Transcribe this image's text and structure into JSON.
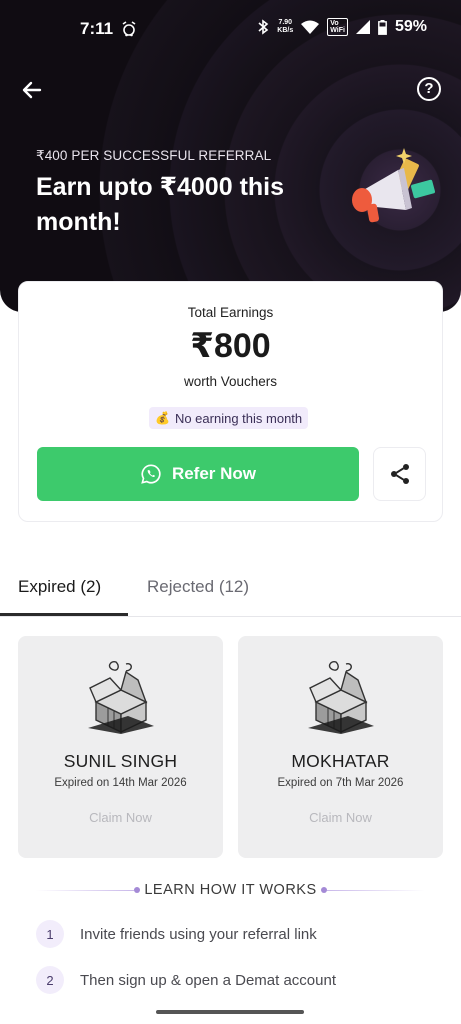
{
  "status": {
    "time": "7:11",
    "speed_value": "7.90",
    "speed_unit": "KB/s",
    "volte_top": "Vo",
    "volte_bottom": "WiFi",
    "battery": "59%"
  },
  "hero": {
    "subtitle": "₹400 PER SUCCESSFUL REFERRAL",
    "title": "Earn upto ₹4000 this month!",
    "help_label": "?"
  },
  "earnings": {
    "label": "Total Earnings",
    "amount": "₹800",
    "worth": "worth Vouchers",
    "badge_icon": "💰",
    "badge": "No earning this month"
  },
  "actions": {
    "refer_label": "Refer Now"
  },
  "tabs": [
    {
      "label": "Expired (2)",
      "active": true
    },
    {
      "label": "Rejected (12)",
      "active": false
    }
  ],
  "referrals": [
    {
      "name": "SUNIL SINGH",
      "date": "Expired on 14th Mar 2026",
      "claim": "Claim Now"
    },
    {
      "name": "MOKHATAR",
      "date": "Expired on 7th Mar 2026",
      "claim": "Claim Now"
    }
  ],
  "learn": {
    "heading": "LEARN HOW IT WORKS",
    "steps": [
      {
        "num": "1",
        "text": "Invite friends using your referral link"
      },
      {
        "num": "2",
        "text": "Then sign up & open a Demat account"
      }
    ]
  },
  "colors": {
    "refer_button": "#3dca6c",
    "badge_bg": "#f1ebfb",
    "hero_bg": "#17121b"
  }
}
